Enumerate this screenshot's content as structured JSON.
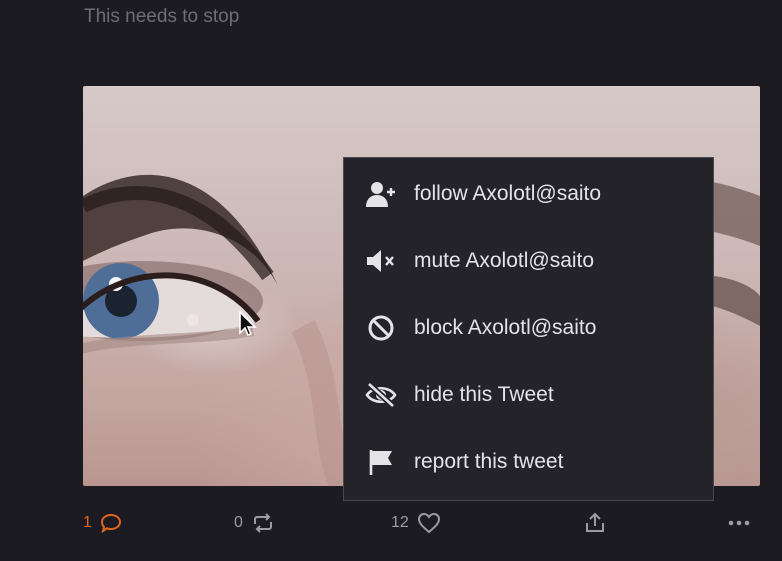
{
  "post": {
    "text": "This needs to stop"
  },
  "context_menu": {
    "items": [
      {
        "label": "follow Axolotl@saito",
        "icon": "follow-user-icon"
      },
      {
        "label": "mute Axolotl@saito",
        "icon": "mute-icon"
      },
      {
        "label": "block Axolotl@saito",
        "icon": "block-icon"
      },
      {
        "label": "hide this Tweet",
        "icon": "hide-eye-icon"
      },
      {
        "label": "report this tweet",
        "icon": "flag-icon"
      }
    ]
  },
  "actions": {
    "replies": "1",
    "retweets": "0",
    "likes": "12"
  },
  "colors": {
    "background": "#1c1b21",
    "menu_bg": "#24232a",
    "accent": "#e0651f",
    "muted_text": "#9c9aa3"
  }
}
